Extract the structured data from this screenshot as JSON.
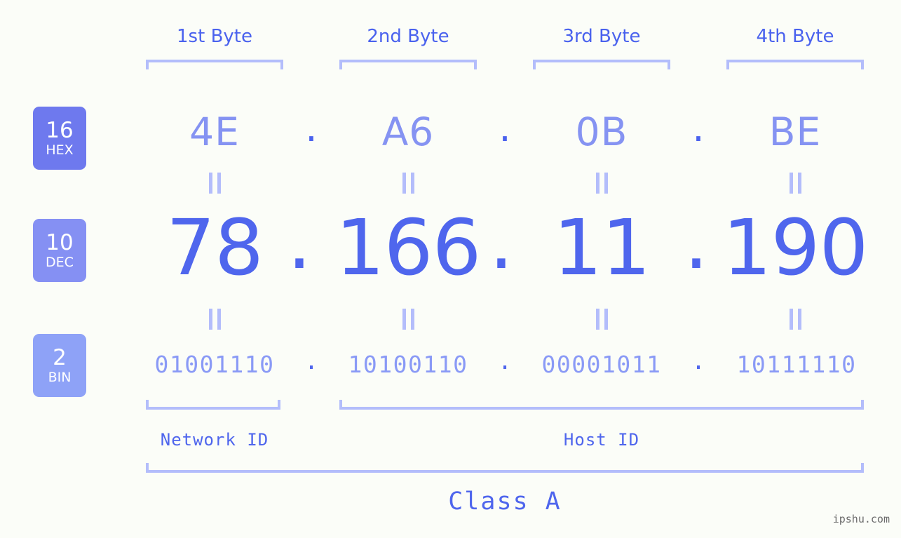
{
  "ip": {
    "decimal": "78.166.11.190",
    "class": "Class A"
  },
  "byte_headers": [
    {
      "label": "1st Byte"
    },
    {
      "label": "2nd Byte"
    },
    {
      "label": "3rd Byte"
    },
    {
      "label": "4th Byte"
    }
  ],
  "rows": {
    "hex": {
      "badge_number": "16",
      "badge_name": "HEX",
      "values": [
        "4E",
        "A6",
        "0B",
        "BE"
      ],
      "separator": "."
    },
    "dec": {
      "badge_number": "10",
      "badge_name": "DEC",
      "values": [
        "78",
        "166",
        "11",
        "190"
      ],
      "separator": "."
    },
    "bin": {
      "badge_number": "2",
      "badge_name": "BIN",
      "values": [
        "01001110",
        "10100110",
        "00001011",
        "10111110"
      ],
      "separator": "."
    }
  },
  "equality_mark": "=",
  "sections": {
    "network_id": "Network ID",
    "host_id": "Host ID",
    "class": "Class A"
  },
  "watermark": "ipshu.com",
  "colors": {
    "background": "#fbfdf8",
    "accent_strong": "#4f66ed",
    "accent_mid": "#8593f2",
    "accent_light": "#b3bdfb",
    "badge_hex": "#6e79ee",
    "badge_dec": "#8590f3",
    "badge_bin": "#8ea2f7"
  }
}
